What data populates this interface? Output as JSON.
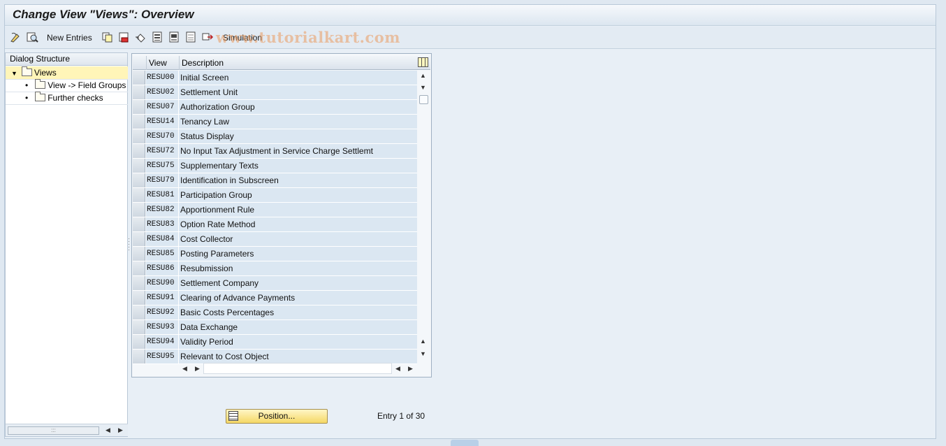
{
  "window": {
    "title": "Change View \"Views\": Overview"
  },
  "toolbar": {
    "new_entries_label": "New Entries",
    "simulation_label": "Simulation",
    "watermark": "www.tutorialkart.com"
  },
  "tree": {
    "header": "Dialog Structure",
    "items": [
      {
        "label": "Views",
        "level": 0,
        "expanded": true,
        "selected": true
      },
      {
        "label": "View -> Field Groups",
        "level": 1
      },
      {
        "label": "Further checks",
        "level": 1
      }
    ]
  },
  "table": {
    "columns": {
      "view": "View",
      "description": "Description"
    },
    "rows": [
      {
        "view": "RESU00",
        "description": "Initial Screen"
      },
      {
        "view": "RESU02",
        "description": "Settlement Unit"
      },
      {
        "view": "RESU07",
        "description": "Authorization Group"
      },
      {
        "view": "RESU14",
        "description": "Tenancy Law"
      },
      {
        "view": "RESU70",
        "description": "Status Display"
      },
      {
        "view": "RESU72",
        "description": "No Input Tax Adjustment in Service Charge Settlemt"
      },
      {
        "view": "RESU75",
        "description": "Supplementary Texts"
      },
      {
        "view": "RESU79",
        "description": "Identification in Subscreen"
      },
      {
        "view": "RESU81",
        "description": "Participation Group"
      },
      {
        "view": "RESU82",
        "description": "Apportionment Rule"
      },
      {
        "view": "RESU83",
        "description": "Option Rate Method"
      },
      {
        "view": "RESU84",
        "description": "Cost Collector"
      },
      {
        "view": "RESU85",
        "description": "Posting Parameters"
      },
      {
        "view": "RESU86",
        "description": "Resubmission"
      },
      {
        "view": "RESU90",
        "description": "Settlement Company"
      },
      {
        "view": "RESU91",
        "description": "Clearing of Advance Payments"
      },
      {
        "view": "RESU92",
        "description": "Basic Costs Percentages"
      },
      {
        "view": "RESU93",
        "description": "Data Exchange"
      },
      {
        "view": "RESU94",
        "description": "Validity Period"
      },
      {
        "view": "RESU95",
        "description": "Relevant to Cost Object"
      }
    ]
  },
  "footer": {
    "position_button": "Position...",
    "entry_info": "Entry 1 of 30"
  },
  "icons": [
    "display-change-icon",
    "details-icon",
    "copy-icon",
    "delete-icon",
    "undo-icon",
    "select-all-icon",
    "select-block-icon",
    "deselect-all-icon",
    "simulation-icon",
    "column-settings-icon",
    "folder-icon"
  ],
  "colors": {
    "table_cell": "#dbe7f2",
    "selected_tree_row": "#fff5b8",
    "position_button": "#f5d865",
    "background": "#dfe8f1"
  }
}
